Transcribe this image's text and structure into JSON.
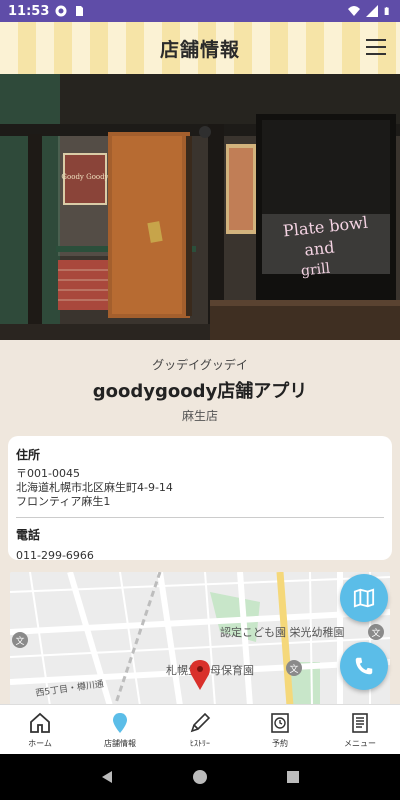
{
  "status_bar": {
    "time": "11:53"
  },
  "header": {
    "title": "店舗情報"
  },
  "store": {
    "kana": "グッデイグッデイ",
    "name": "goodygoody店舗アプリ",
    "branch": "麻生店"
  },
  "address": {
    "label": "住所",
    "postal": "〒001-0045",
    "line1": "北海道札幌市北区麻生町4-9-14",
    "line2": "フロンティア麻生1"
  },
  "phone": {
    "label": "電話",
    "number": "011-299-6966"
  },
  "map": {
    "labels": {
      "kindergarten": "認定こども園 栄光幼稚園",
      "nursery": "札幌生雲母保育園",
      "street": "西5丁目・樽川通",
      "bunkyo1": "文",
      "bunkyo2": "文",
      "bunkyo3": "文"
    }
  },
  "hero_signs": {
    "sign_goody": "Goody Goody",
    "window_text1": "Plate bowl",
    "window_text2": "and",
    "window_text3": "grill"
  },
  "bottom_nav": [
    {
      "label": "ホーム",
      "icon": "home-icon"
    },
    {
      "label": "店舗情報",
      "icon": "location-pin-icon"
    },
    {
      "label": "ﾋｽﾄﾘｰ",
      "icon": "pen-icon"
    },
    {
      "label": "予約",
      "icon": "clock-icon"
    },
    {
      "label": "メニュー",
      "icon": "menu-book-icon"
    }
  ],
  "colors": {
    "status_bar": "#5f4da8",
    "fab": "#5bbde8",
    "background": "#efe7dd",
    "map_pin": "#d9302b"
  }
}
